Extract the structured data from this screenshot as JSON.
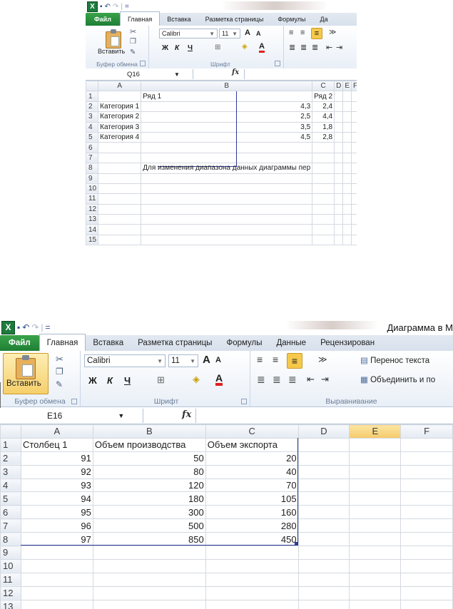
{
  "screenshot1": {
    "qat": {
      "logo": "X",
      "save": "▪",
      "undo": "↶",
      "redo": "↷",
      "sep": "|",
      "more": "="
    },
    "tabs": [
      "Файл",
      "Главная",
      "Вставка",
      "Разметка страницы",
      "Формулы",
      "Да"
    ],
    "clipboard": {
      "paste_label": "Вставить",
      "group_label": "Буфер обмена"
    },
    "font": {
      "name": "Calibri",
      "size": "11",
      "grow": "A",
      "shrink": "A",
      "bold": "Ж",
      "italic": "К",
      "underline": "Ч",
      "group_label": "Шрифт"
    },
    "formula_bar": {
      "cell": "Q16",
      "fx": "fx",
      "value": ""
    },
    "columns": [
      "A",
      "B",
      "C",
      "D",
      "E",
      "F"
    ],
    "rows": [
      {
        "n": "1",
        "a": "",
        "b": "Ряд 1",
        "c": "Ряд 2"
      },
      {
        "n": "2",
        "a": "Категория 1",
        "b": "4,3",
        "c": "2,4"
      },
      {
        "n": "3",
        "a": "Категория 2",
        "b": "2,5",
        "c": "4,4"
      },
      {
        "n": "4",
        "a": "Категория 3",
        "b": "3,5",
        "c": "1,8"
      },
      {
        "n": "5",
        "a": "Категория 4",
        "b": "4,5",
        "c": "2,8"
      },
      {
        "n": "6",
        "a": "",
        "b": "",
        "c": ""
      },
      {
        "n": "7",
        "a": "",
        "b": "",
        "c": ""
      },
      {
        "n": "8",
        "a": "",
        "b": "Для изменения диапазона данных диаграммы пер",
        "c": ""
      },
      {
        "n": "9"
      },
      {
        "n": "10"
      },
      {
        "n": "11"
      },
      {
        "n": "12"
      },
      {
        "n": "13"
      },
      {
        "n": "14"
      },
      {
        "n": "15"
      }
    ]
  },
  "screenshot2": {
    "qat": {
      "logo": "X",
      "save": "▪",
      "undo": "↶",
      "redo": "↷",
      "sep": "|",
      "more": "="
    },
    "window_title": "Диаграмма в М",
    "tabs": [
      "Файл",
      "Главная",
      "Вставка",
      "Разметка страницы",
      "Формулы",
      "Данные",
      "Рецензирован"
    ],
    "clipboard": {
      "paste_label": "Вставить",
      "group_label": "Буфер обмена"
    },
    "font": {
      "name": "Calibri",
      "size": "11",
      "grow": "A",
      "shrink": "A",
      "bold": "Ж",
      "italic": "К",
      "underline": "Ч",
      "group_label": "Шрифт"
    },
    "alignment": {
      "wrap": "Перенос текста",
      "merge": "Объединить и по",
      "group_label": "Выравнивание"
    },
    "formula_bar": {
      "cell": "E16",
      "fx": "fx",
      "value": ""
    },
    "columns": [
      "A",
      "B",
      "C",
      "D",
      "E",
      "F"
    ],
    "rows": [
      {
        "n": "1",
        "a": "Столбец 1",
        "b": "Объем производства",
        "c": "Объем экспорта"
      },
      {
        "n": "2",
        "a": "91",
        "b": "50",
        "c": "20"
      },
      {
        "n": "3",
        "a": "92",
        "b": "80",
        "c": "40"
      },
      {
        "n": "4",
        "a": "93",
        "b": "120",
        "c": "70"
      },
      {
        "n": "5",
        "a": "94",
        "b": "180",
        "c": "105"
      },
      {
        "n": "6",
        "a": "95",
        "b": "300",
        "c": "160"
      },
      {
        "n": "7",
        "a": "96",
        "b": "500",
        "c": "280"
      },
      {
        "n": "8",
        "a": "97",
        "b": "850",
        "c": "450"
      },
      {
        "n": "9"
      },
      {
        "n": "10"
      },
      {
        "n": "11"
      },
      {
        "n": "12"
      },
      {
        "n": "13"
      }
    ]
  }
}
